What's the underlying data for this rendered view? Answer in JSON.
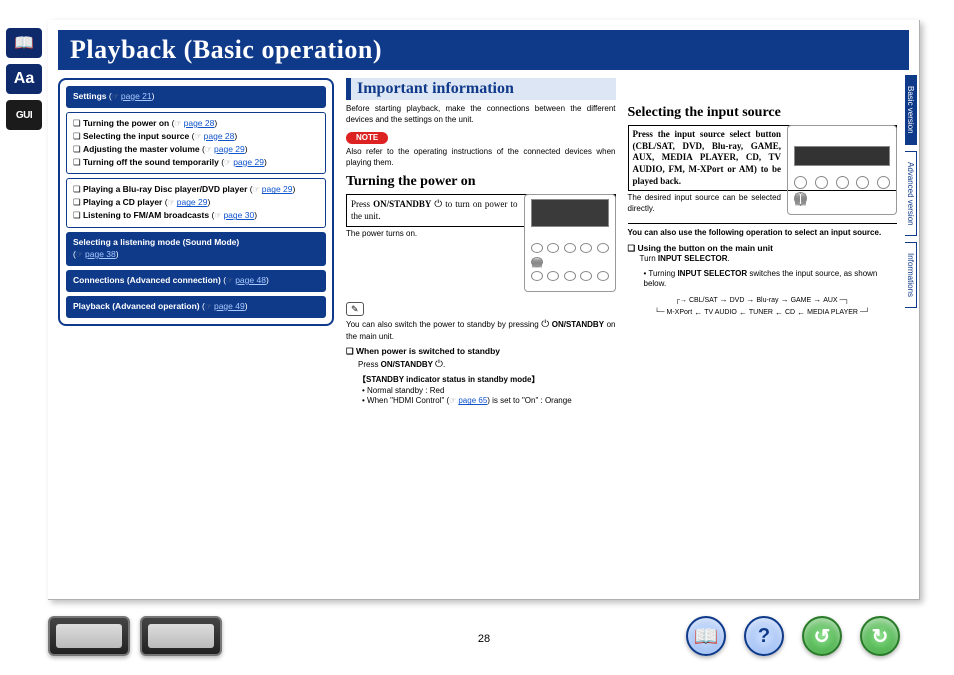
{
  "page_title": "Playback (Basic operation)",
  "page_number": "28",
  "rail": {
    "book": "📖",
    "aa": "Aa",
    "gui": "GUI"
  },
  "vtabs": {
    "basic": "Basic version",
    "advanced": "Advanced version",
    "info": "Informations"
  },
  "sidebar": {
    "settings": {
      "label": "Settings",
      "page": "page 21"
    },
    "group1": [
      {
        "label": "Turning the power on",
        "page": "page 28"
      },
      {
        "label": "Selecting the input source",
        "page": "page 28"
      },
      {
        "label": "Adjusting the master volume",
        "page": "page 29"
      },
      {
        "label": "Turning off the sound temporarily",
        "page": "page 29"
      }
    ],
    "group2": [
      {
        "label": "Playing a Blu-ray Disc player/DVD player",
        "page": "page 29"
      },
      {
        "label": "Playing a CD player",
        "page": "page 29"
      },
      {
        "label": "Listening to FM/AM broadcasts",
        "page": "page 30"
      }
    ],
    "soundmode": {
      "label": "Selecting a listening mode (Sound Mode)",
      "page": "page 38"
    },
    "connections": {
      "label": "Connections (Advanced connection)",
      "page": "page 48"
    },
    "playback_adv": {
      "label": "Playback (Advanced operation)",
      "page": "page 49"
    }
  },
  "important": {
    "heading": "Important information",
    "p1": "Before starting playback, make the connections between the different devices and the settings on the unit.",
    "note_label": "NOTE",
    "note_body": "Also refer to the operating instructions of the connected devices when playing them."
  },
  "power": {
    "heading": "Turning the power on",
    "framed_a": "Press ",
    "framed_b": "ON/STANDBY ",
    "framed_c": " to turn on power to the unit.",
    "p_on": "The power turns on.",
    "tip_icon": "✎",
    "tip_a": "You can also switch the power to standby by pressing ",
    "tip_b": "ON/STANDBY",
    "tip_c": " on the main unit.",
    "sub": "When power is switched to standby",
    "press": "Press ",
    "press_b": "ON/STANDBY ",
    "press_c": ".",
    "bracket": "【STANDBY indicator status in standby mode】",
    "b1": "Normal standby : Red",
    "b2_a": "When \"HDMI Control\" (",
    "b2_page": "page 65",
    "b2_b": ") is set to \"On\" : Orange"
  },
  "select": {
    "heading": "Selecting the input source",
    "framed": "Press the input source select button (CBL/SAT, DVD, Blu-ray, GAME, AUX, MEDIA PLAYER, CD, TV AUDIO, FM, M-XPort or AM) to be played back.",
    "p1": "The desired input source can be selected directly.",
    "p2": "You can also use the following operation to select an input source.",
    "sub": "Using the button on the main unit",
    "turn_a": "Turn ",
    "turn_b": "INPUT SELECTOR",
    "turn_c": ".",
    "b1_a": "Turning ",
    "b1_b": "INPUT SELECTOR",
    "b1_c": " switches the input source, as shown below.",
    "seq1": [
      "CBL/SAT",
      "DVD",
      "Blu-ray",
      "GAME",
      "AUX"
    ],
    "seq2": [
      "M-XPort",
      "TV AUDIO",
      "TUNER",
      "CD",
      "MEDIA PLAYER"
    ]
  },
  "nav": {
    "book": "📖",
    "help": "?",
    "back": "↺",
    "fwd": "↻"
  }
}
